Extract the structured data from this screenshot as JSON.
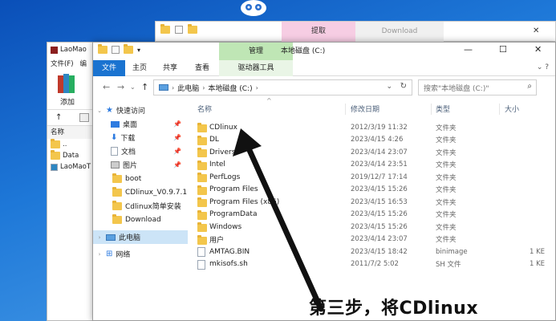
{
  "bg_window": {
    "tab_extract": "提取",
    "tab_download": "Download"
  },
  "laomao_window": {
    "title": "LaoMao",
    "menu": [
      "文件(F)",
      "编"
    ],
    "add_label": "添加",
    "list_header": "名称",
    "rows": [
      "..",
      "Data",
      "LaoMaoT"
    ]
  },
  "window": {
    "manage_tab": "管理",
    "title": "本地磁盘 (C:)",
    "ribbon_tabs": [
      "文件",
      "主页",
      "共享",
      "查看",
      "驱动器工具"
    ],
    "breadcrumb": [
      "此电脑",
      "本地磁盘 (C:)"
    ],
    "search_placeholder": "搜索\"本地磁盘 (C:)\""
  },
  "nav": {
    "quick_access": "快速访问",
    "items": [
      {
        "label": "桌面",
        "pinned": true
      },
      {
        "label": "下载",
        "pinned": true
      },
      {
        "label": "文档",
        "pinned": true
      },
      {
        "label": "图片",
        "pinned": true
      },
      {
        "label": "boot",
        "pinned": false
      },
      {
        "label": "CDlinux_V0.9.7.1",
        "pinned": false
      },
      {
        "label": "Cdlinux简单安装",
        "pinned": false
      },
      {
        "label": "Download",
        "pinned": false
      }
    ],
    "this_pc": "此电脑",
    "network": "网络"
  },
  "columns": {
    "name": "名称",
    "date": "修改日期",
    "type": "类型",
    "size": "大小"
  },
  "files": [
    {
      "name": "CDlinux",
      "date": "2012/3/19 11:32",
      "type": "文件夹",
      "size": "",
      "kind": "folder"
    },
    {
      "name": "DL",
      "date": "2023/4/15 4:26",
      "type": "文件夹",
      "size": "",
      "kind": "folder"
    },
    {
      "name": "Drivers",
      "date": "2023/4/14 23:07",
      "type": "文件夹",
      "size": "",
      "kind": "folder"
    },
    {
      "name": "Intel",
      "date": "2023/4/14 23:51",
      "type": "文件夹",
      "size": "",
      "kind": "folder"
    },
    {
      "name": "PerfLogs",
      "date": "2019/12/7 17:14",
      "type": "文件夹",
      "size": "",
      "kind": "folder"
    },
    {
      "name": "Program Files",
      "date": "2023/4/15 15:26",
      "type": "文件夹",
      "size": "",
      "kind": "folder"
    },
    {
      "name": "Program Files (x86)",
      "date": "2023/4/15 16:53",
      "type": "文件夹",
      "size": "",
      "kind": "folder"
    },
    {
      "name": "ProgramData",
      "date": "2023/4/15 15:26",
      "type": "文件夹",
      "size": "",
      "kind": "folder"
    },
    {
      "name": "Windows",
      "date": "2023/4/15 15:26",
      "type": "文件夹",
      "size": "",
      "kind": "folder"
    },
    {
      "name": "用户",
      "date": "2023/4/14 23:07",
      "type": "文件夹",
      "size": "",
      "kind": "folder"
    },
    {
      "name": "AMTAG.BIN",
      "date": "2023/4/15 18:42",
      "type": "binimage",
      "size": "1 KE",
      "kind": "file"
    },
    {
      "name": "mkisofs.sh",
      "date": "2011/7/2 5:02",
      "type": "SH 文件",
      "size": "1 KE",
      "kind": "file"
    }
  ],
  "overlay": {
    "line1": "第三步，将CDlinux",
    "accent_color": "#111111"
  }
}
